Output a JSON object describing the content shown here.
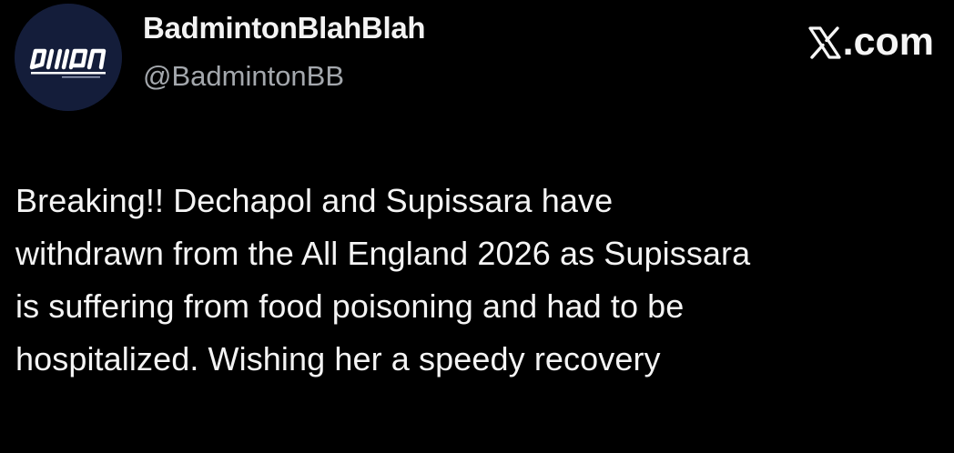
{
  "author": {
    "display_name": "BadmintonBlahBlah",
    "handle": "@BadmintonBB",
    "avatar": {
      "icon": "badminton-logo-icon",
      "logo_text": "บาแบด",
      "background": "#141d3a"
    }
  },
  "site": {
    "icon": "x-logo-icon",
    "label": ".com"
  },
  "tweet": {
    "lines": [
      "Breaking!! Dechapol and Supissara have",
      "withdrawn from the All England 2026 as Supissara",
      "is suffering from food poisoning and had to be",
      "hospitalized. Wishing her a speedy recovery"
    ]
  },
  "colors": {
    "background": "#000000",
    "text": "#f4f4f4",
    "handle": "#a4a8ad"
  }
}
